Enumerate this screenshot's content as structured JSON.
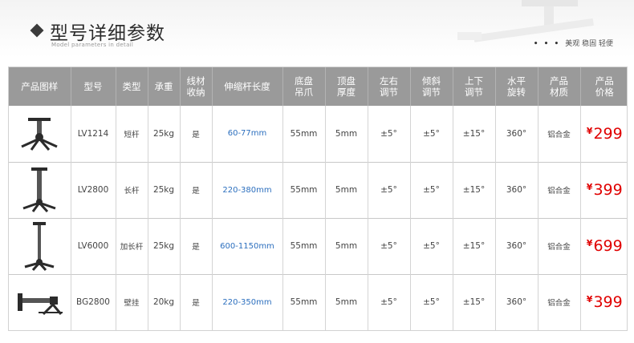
{
  "header": {
    "title": "型号详细参数",
    "subtitle": "Model parameters in detail",
    "slogan_dots": "• • •",
    "slogan": "美观 稳固 轻便"
  },
  "table": {
    "columns": [
      {
        "l1": "产品图样",
        "l2": ""
      },
      {
        "l1": "型号",
        "l2": ""
      },
      {
        "l1": "类型",
        "l2": ""
      },
      {
        "l1": "承重",
        "l2": ""
      },
      {
        "l1": "线材",
        "l2": "收纳"
      },
      {
        "l1": "伸缩杆长度",
        "l2": ""
      },
      {
        "l1": "底盘",
        "l2": "吊爪"
      },
      {
        "l1": "顶盘",
        "l2": "厚度"
      },
      {
        "l1": "左右",
        "l2": "调节"
      },
      {
        "l1": "倾斜",
        "l2": "调节"
      },
      {
        "l1": "上下",
        "l2": "调节"
      },
      {
        "l1": "水平",
        "l2": "旋转"
      },
      {
        "l1": "产品",
        "l2": "材质"
      },
      {
        "l1": "产品",
        "l2": "价格"
      }
    ],
    "rows": [
      {
        "image_icon": "short-ceiling-mount-icon",
        "model": "LV1214",
        "type": "短杆",
        "load": "25kg",
        "cable": "是",
        "length": "60-77mm",
        "claw": "55mm",
        "thickness": "5mm",
        "lr": "±5°",
        "tilt": "±5°",
        "ud": "±15°",
        "rotate": "360°",
        "material": "铝合金",
        "currency": "¥",
        "price": "299"
      },
      {
        "image_icon": "long-ceiling-mount-icon",
        "model": "LV2800",
        "type": "长杆",
        "load": "25kg",
        "cable": "是",
        "length": "220-380mm",
        "claw": "55mm",
        "thickness": "5mm",
        "lr": "±5°",
        "tilt": "±5°",
        "ud": "±15°",
        "rotate": "360°",
        "material": "铝合金",
        "currency": "¥",
        "price": "399"
      },
      {
        "image_icon": "extra-long-ceiling-mount-icon",
        "model": "LV6000",
        "type": "加长杆",
        "load": "25kg",
        "cable": "是",
        "length": "600-1150mm",
        "claw": "55mm",
        "thickness": "5mm",
        "lr": "±5°",
        "tilt": "±5°",
        "ud": "±15°",
        "rotate": "360°",
        "material": "铝合金",
        "currency": "¥",
        "price": "699"
      },
      {
        "image_icon": "wall-mount-icon",
        "model": "BG2800",
        "type": "壁挂",
        "load": "20kg",
        "cable": "是",
        "length": "220-350mm",
        "claw": "55mm",
        "thickness": "5mm",
        "lr": "±5°",
        "tilt": "±5°",
        "ud": "±15°",
        "rotate": "360°",
        "material": "铝合金",
        "currency": "¥",
        "price": "399"
      }
    ]
  },
  "colors": {
    "header_bg": "#9a9a9a",
    "price": "#e00000",
    "length_text": "#2c6fbe"
  }
}
